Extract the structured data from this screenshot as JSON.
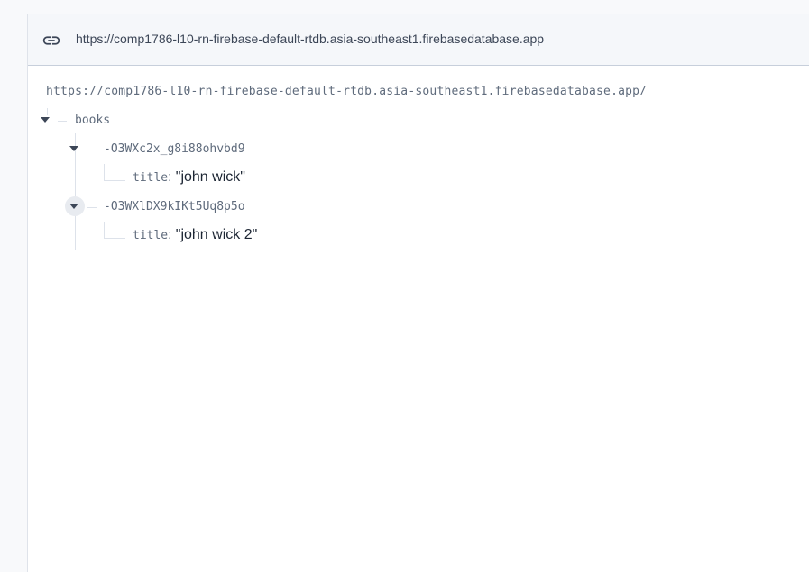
{
  "url_bar": {
    "icon": "link-icon",
    "text": "https://comp1786-l10-rn-firebase-default-rtdb.asia-southeast1.firebasedatabase.app"
  },
  "tree": {
    "root_url": "https://comp1786-l10-rn-firebase-default-rtdb.asia-southeast1.firebasedatabase.app/",
    "books": {
      "key": "books",
      "children": [
        {
          "key": "-O3WXc2x_g8i88ohvbd9",
          "field": "title",
          "separator": ":",
          "value": "\"john wick\""
        },
        {
          "key": "-O3WXlDX9kIKt5Uq8p5o",
          "field": "title",
          "separator": ":",
          "value": "\"john wick 2\""
        }
      ]
    }
  },
  "colors": {
    "key_text": "#5f6b7c",
    "value_text": "#1c2533",
    "tree_line": "#dde2ea",
    "url_bar_bg": "#f5f7fa"
  }
}
